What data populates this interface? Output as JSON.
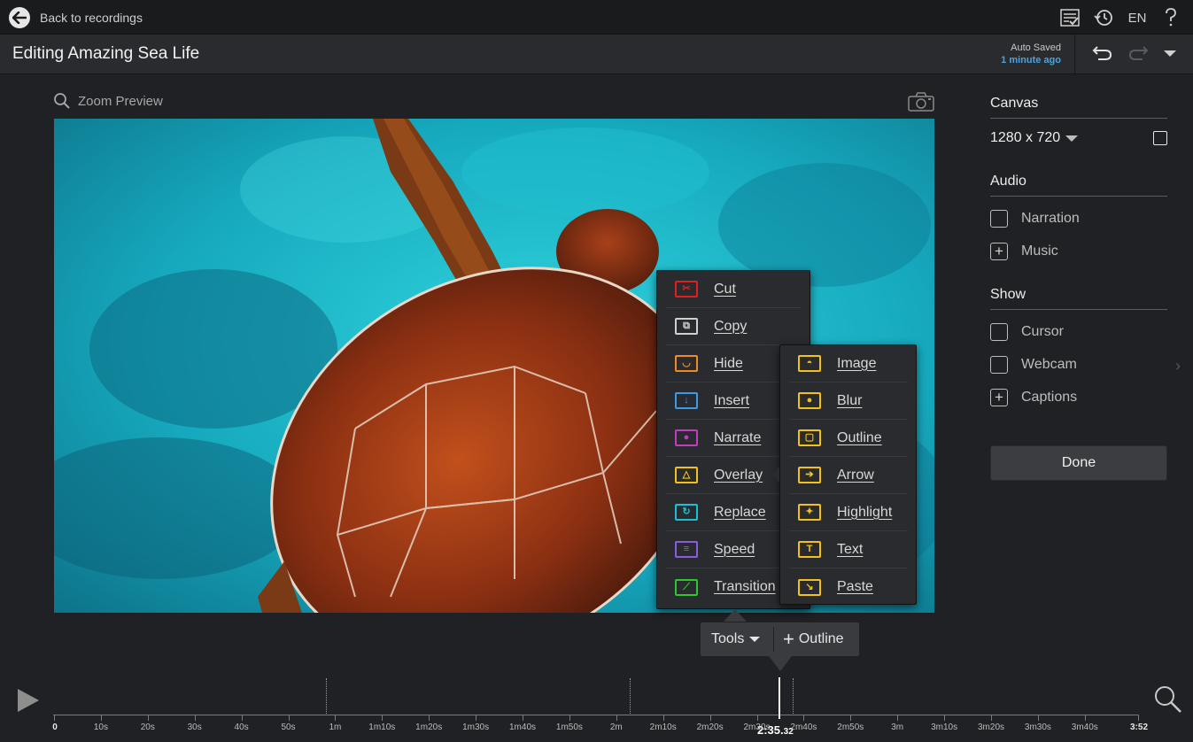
{
  "topbar": {
    "back_label": "Back to recordings",
    "language": "EN"
  },
  "titlebar": {
    "title": "Editing Amazing Sea Life",
    "autosave_label": "Auto Saved",
    "autosave_time": "1 minute ago"
  },
  "preview": {
    "zoom_label": "Zoom Preview"
  },
  "panel": {
    "canvas_title": "Canvas",
    "resolution": "1280 x 720",
    "audio_title": "Audio",
    "audio_items": [
      "Narration",
      "Music"
    ],
    "show_title": "Show",
    "show_items": [
      "Cursor",
      "Webcam",
      "Captions"
    ],
    "done_label": "Done"
  },
  "tools_menu": {
    "items": [
      {
        "label": "Cut",
        "icon": "scissors-icon",
        "color": "#e02020"
      },
      {
        "label": "Copy",
        "icon": "copy-icon",
        "color": "#d0d0d0"
      },
      {
        "label": "Hide",
        "icon": "eye-closed-icon",
        "color": "#f08a24"
      },
      {
        "label": "Insert",
        "icon": "insert-icon",
        "color": "#3a9be8"
      },
      {
        "label": "Narrate",
        "icon": "narrate-icon",
        "color": "#c23cc2"
      },
      {
        "label": "Overlay",
        "icon": "overlay-icon",
        "color": "#f2c21b"
      },
      {
        "label": "Replace",
        "icon": "replace-icon",
        "color": "#1cc0d6"
      },
      {
        "label": "Speed",
        "icon": "speed-icon",
        "color": "#8a5ce0"
      },
      {
        "label": "Transition",
        "icon": "transition-icon",
        "color": "#2ec72e"
      }
    ]
  },
  "overlay_menu": {
    "items": [
      {
        "label": "Image",
        "icon": "image-icon"
      },
      {
        "label": "Blur",
        "icon": "blur-drop-icon"
      },
      {
        "label": "Outline",
        "icon": "outline-icon"
      },
      {
        "label": "Arrow",
        "icon": "arrow-icon"
      },
      {
        "label": "Highlight",
        "icon": "highlight-star-icon"
      },
      {
        "label": "Text",
        "icon": "text-icon"
      },
      {
        "label": "Paste",
        "icon": "paste-icon"
      }
    ],
    "color": "#f2c21b"
  },
  "toolbar": {
    "tools_label": "Tools",
    "outline_label": "Outline"
  },
  "timeline": {
    "labels": [
      "0",
      "10s",
      "20s",
      "30s",
      "40s",
      "50s",
      "1m",
      "1m10s",
      "1m20s",
      "1m30s",
      "1m40s",
      "1m50s",
      "2m",
      "2m10s",
      "2m20s",
      "2m30s",
      "2m40s",
      "2m50s",
      "3m",
      "3m10s",
      "3m20s",
      "3m30s",
      "3m40s"
    ],
    "end_label": "3:52",
    "playhead_main": "2:35.",
    "playhead_frac": "32"
  }
}
